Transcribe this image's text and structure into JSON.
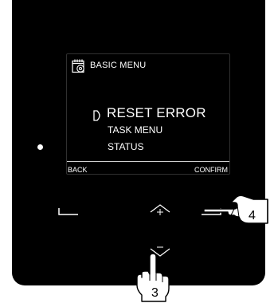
{
  "screen": {
    "menu_title": "BASIC MENU",
    "menu_icon": "calendar-gear-icon",
    "selected_item": "RESET ERROR",
    "items": [
      "TASK MENU",
      "STATUS"
    ],
    "soft_left": "BACK",
    "soft_right": "CONFIRM"
  },
  "callouts": {
    "right_hand_step": "4",
    "down_hand_step": "3"
  },
  "colors": {
    "device": "#000000",
    "screen_text": "#ffffff",
    "background": "#ffffff"
  }
}
